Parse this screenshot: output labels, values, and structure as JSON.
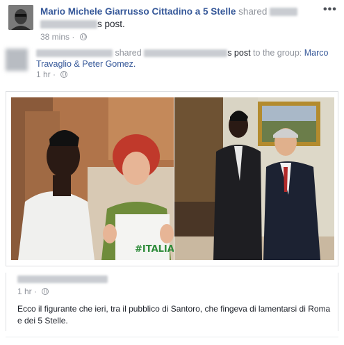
{
  "post": {
    "author": "Mario Michele Giarrusso Cittadino a 5 Stelle",
    "shared_word": "shared",
    "post_suffix": "s post.",
    "time": "38 mins",
    "privacy_icon": "globe-icon",
    "more_icon": "more-dots-icon",
    "more_label": "•••"
  },
  "shared": {
    "shared_word": "shared",
    "post_link": "s post",
    "to_group": "to the group:",
    "group_name": "Marco Travaglio & Peter Gomez.",
    "time": "1 hr"
  },
  "media": {
    "left_caption": "#ITALIANI"
  },
  "comment": {
    "time": "1 hr",
    "text": "Ecco il figurante che ieri, tra il pubblico di Santoro, che fingeva di lamentarsi di Roma e dei 5 Stelle."
  },
  "colors": {
    "link": "#365899",
    "meta": "#90949c",
    "text": "#1d2129",
    "border": "#dddfe2"
  }
}
